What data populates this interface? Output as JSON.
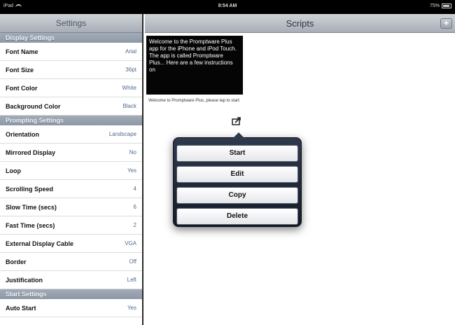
{
  "status_bar": {
    "device": "iPad",
    "time": "8:54 AM",
    "battery": "75%"
  },
  "settings": {
    "title": "Settings",
    "sections": [
      {
        "header": "Display Settings",
        "rows": [
          {
            "label": "Font Name",
            "value": "Arial"
          },
          {
            "label": "Font Size",
            "value": "36pt"
          },
          {
            "label": "Font Color",
            "value": "White"
          },
          {
            "label": "Background Color",
            "value": "Black"
          }
        ]
      },
      {
        "header": "Prompting Settings",
        "rows": [
          {
            "label": "Orientation",
            "value": "Landscape"
          },
          {
            "label": "Mirrored Display",
            "value": "No"
          },
          {
            "label": "Loop",
            "value": "Yes"
          },
          {
            "label": "Scrolling Speed",
            "value": "4"
          },
          {
            "label": "Slow Time (secs)",
            "value": "6"
          },
          {
            "label": "Fast Time (secs)",
            "value": "2"
          },
          {
            "label": "External Display Cable",
            "value": "VGA"
          },
          {
            "label": "Border",
            "value": "Off"
          },
          {
            "label": "Justification",
            "value": "Left"
          }
        ]
      },
      {
        "header": "Start Settings",
        "rows": [
          {
            "label": "Auto Start",
            "value": "Yes"
          }
        ]
      }
    ]
  },
  "scripts": {
    "title": "Scripts",
    "add_label": "+",
    "item": {
      "preview": "Welcome to the Promptware Plus app for the iPhone and iPod Touch. The app is called Promptware Plus... Here are a few instructions on",
      "caption": "Welcome to Promptware Plus, please tap to start"
    }
  },
  "popover": {
    "start": "Start",
    "edit": "Edit",
    "copy": "Copy",
    "delete": "Delete"
  }
}
